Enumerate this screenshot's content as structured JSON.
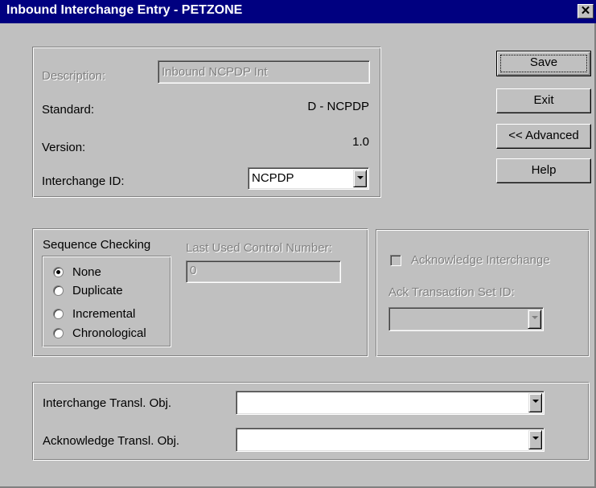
{
  "window": {
    "title": "Inbound Interchange Entry - PETZONE",
    "close_glyph": "✕"
  },
  "header_group": {
    "description_label": "Description:",
    "description_value": "Inbound NCPDP Int",
    "standard_label": "Standard:",
    "standard_value": "D - NCPDP",
    "version_label": "Version:",
    "version_value": "1.0",
    "interchange_id_label": "Interchange ID:",
    "interchange_id_value": "NCPDP"
  },
  "buttons": {
    "save": "Save",
    "exit": "Exit",
    "advanced": "<< Advanced",
    "help": "Help"
  },
  "sequence_group": {
    "title": "Sequence Checking",
    "options": [
      "None",
      "Duplicate",
      "Incremental",
      "Chronological"
    ],
    "selected": "None",
    "last_used_label": "Last Used Control Number:",
    "last_used_value": "0"
  },
  "ack_group": {
    "acknowledge_label": "Acknowledge Interchange",
    "acknowledge_checked": false,
    "ack_set_label": "Ack Transaction Set ID:",
    "ack_set_value": ""
  },
  "transl_group": {
    "interchange_transl_label": "Interchange Transl. Obj.",
    "interchange_transl_value": "",
    "acknowledge_transl_label": "Acknowledge Transl. Obj.",
    "acknowledge_transl_value": ""
  },
  "colors": {
    "title_bar": "#000080",
    "face": "#c0c0c0",
    "disabled_text": "#808080"
  }
}
